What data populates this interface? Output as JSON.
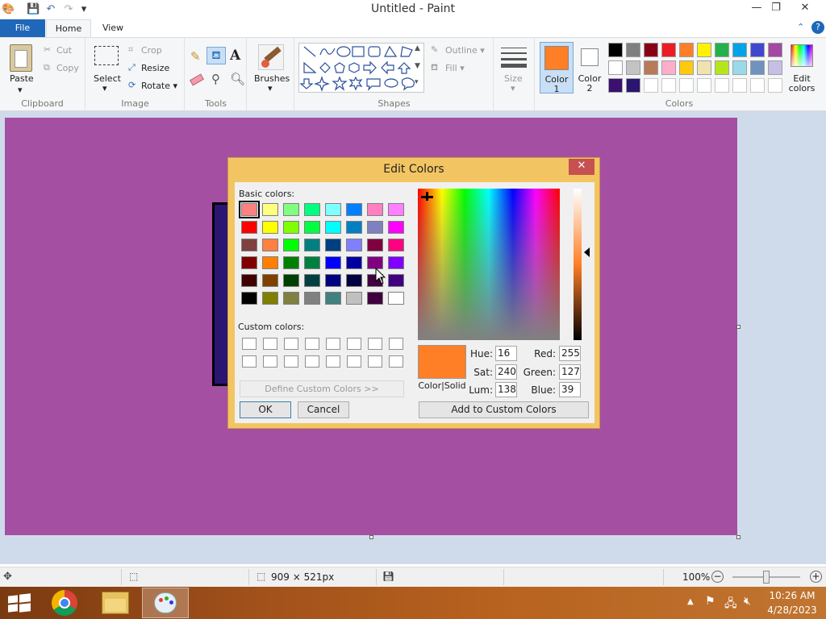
{
  "window": {
    "title": "Untitled - Paint",
    "minimize": "—",
    "restore": "❐",
    "close": "✕"
  },
  "quick_access": {
    "save": "💾",
    "undo": "↶",
    "redo": "↷",
    "customize": "▾"
  },
  "tabs": [
    {
      "label": "File"
    },
    {
      "label": "Home"
    },
    {
      "label": "View"
    }
  ],
  "ribbon": {
    "clipboard": {
      "paste": "Paste",
      "cut": "Cut",
      "copy": "Copy",
      "label": "Clipboard"
    },
    "image": {
      "select": "Select",
      "crop": "Crop",
      "resize": "Resize",
      "rotate": "Rotate",
      "label": "Image"
    },
    "tools": {
      "label": "Tools"
    },
    "brushes": {
      "label": "Brushes"
    },
    "shapes": {
      "outline": "Outline",
      "fill": "Fill",
      "label": "Shapes"
    },
    "size": {
      "label": "Size"
    },
    "color1": {
      "label1": "Color",
      "label2": "1",
      "value": "#ff7f27"
    },
    "color2": {
      "label1": "Color",
      "label2": "2",
      "value": "#ffffff"
    },
    "colors": {
      "label": "Colors",
      "edit_label1": "Edit",
      "edit_label2": "colors"
    },
    "help": "?",
    "collapse": "⌃"
  },
  "palette": {
    "row1": [
      "#000000",
      "#7f7f7f",
      "#880015",
      "#ed1c24",
      "#ff7f27",
      "#fff200",
      "#22b14c",
      "#00a2e8",
      "#3f48cc",
      "#a349a4"
    ],
    "row2": [
      "#ffffff",
      "#c3c3c3",
      "#b97a57",
      "#ffaec9",
      "#ffc90e",
      "#efe4b0",
      "#b5e61d",
      "#99d9ea",
      "#7092be",
      "#c8bfe7"
    ],
    "row3": [
      "#3a1070",
      "#2a1670",
      "",
      "",
      "",
      "",
      "",
      "",
      "",
      ""
    ]
  },
  "dialog": {
    "title": "Edit Colors",
    "close": "✕",
    "basic_colors_label": "Basic colors:",
    "custom_colors_label": "Custom colors:",
    "define_custom": "Define Custom Colors >>",
    "ok": "OK",
    "cancel": "Cancel",
    "color_solid": "Color|Solid",
    "add_custom": "Add to Custom Colors",
    "hue_label": "Hue:",
    "hue": "16",
    "sat_label": "Sat:",
    "sat": "240",
    "lum_label": "Lum:",
    "lum": "138",
    "red_label": "Red:",
    "red": "255",
    "green_label": "Green:",
    "green": "127",
    "blue_label": "Blue:",
    "blue": "39",
    "preview_color": "#ff7f27",
    "basic_colors": [
      [
        "#ff8080",
        "#ffff80",
        "#80ff80",
        "#00ff80",
        "#80ffff",
        "#0080ff",
        "#ff80c0",
        "#ff80ff"
      ],
      [
        "#ff0000",
        "#ffff00",
        "#80ff00",
        "#00ff40",
        "#00ffff",
        "#0080c0",
        "#8080c0",
        "#ff00ff"
      ],
      [
        "#804040",
        "#ff8040",
        "#00ff00",
        "#008080",
        "#004080",
        "#8080ff",
        "#800040",
        "#ff0080"
      ],
      [
        "#800000",
        "#ff8000",
        "#008000",
        "#008040",
        "#0000ff",
        "#0000a0",
        "#800080",
        "#8000ff"
      ],
      [
        "#400000",
        "#804000",
        "#004000",
        "#004040",
        "#000080",
        "#000040",
        "#400040",
        "#400080"
      ],
      [
        "#000000",
        "#808000",
        "#808040",
        "#808080",
        "#408080",
        "#c0c0c0",
        "#400040",
        "#ffffff"
      ]
    ]
  },
  "status": {
    "dimensions": "909 × 521px",
    "zoom": "100%"
  },
  "taskbar": {
    "time": "10:26 AM",
    "date": "4/28/2023"
  }
}
